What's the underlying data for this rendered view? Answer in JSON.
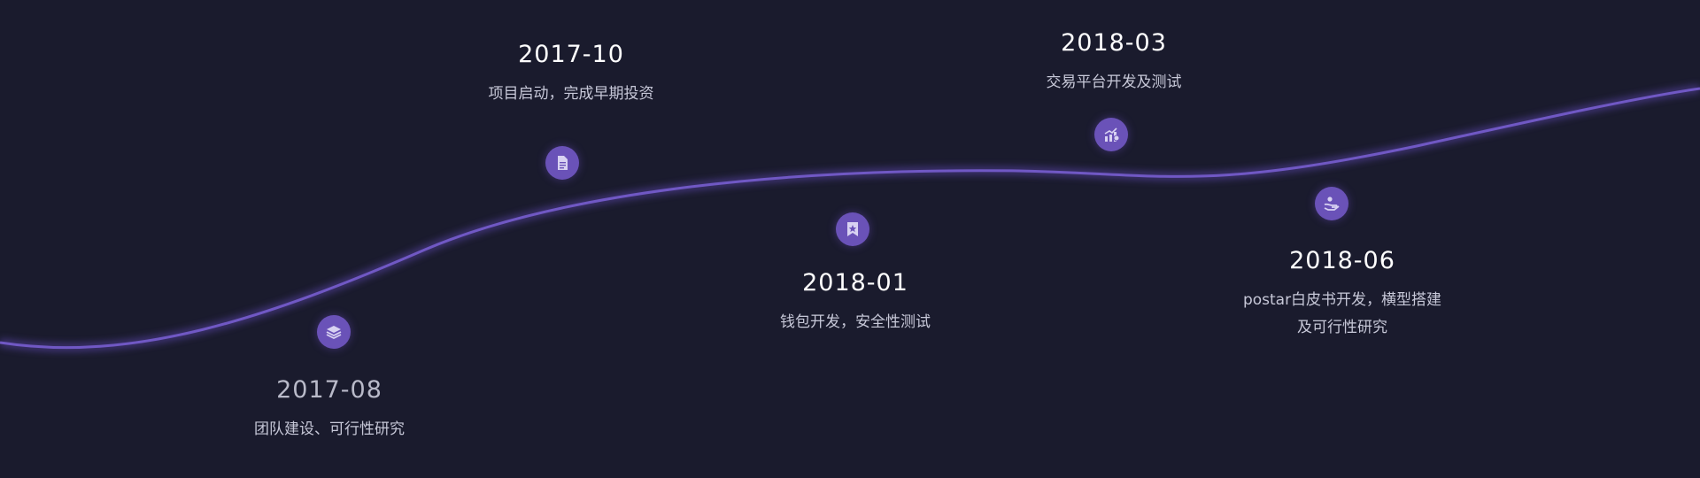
{
  "timeline": {
    "milestones": [
      {
        "id": "2017-08",
        "date": "2017-08",
        "description": "团队建设、可行性研究",
        "icon": "layers-icon"
      },
      {
        "id": "2017-10",
        "date": "2017-10",
        "description": "项目启动，完成早期投资",
        "icon": "document-icon"
      },
      {
        "id": "2018-01",
        "date": "2018-01",
        "description": "钱包开发，安全性测试",
        "icon": "bookmark-star-icon"
      },
      {
        "id": "2018-03",
        "date": "2018-03",
        "description": "交易平台开发及测试",
        "icon": "chart-growth-icon"
      },
      {
        "id": "2018-06",
        "date": "2018-06",
        "description_line1": "postar白皮书开发，横型搭建",
        "description_line2": "及可行性研究",
        "icon": "hand-coin-icon"
      }
    ]
  },
  "colors": {
    "background": "#1a1b2d",
    "curve": "#6a52b8",
    "node": "#6a52b8",
    "date_text": "#ffffff",
    "desc_text": "#c7c8d8"
  }
}
